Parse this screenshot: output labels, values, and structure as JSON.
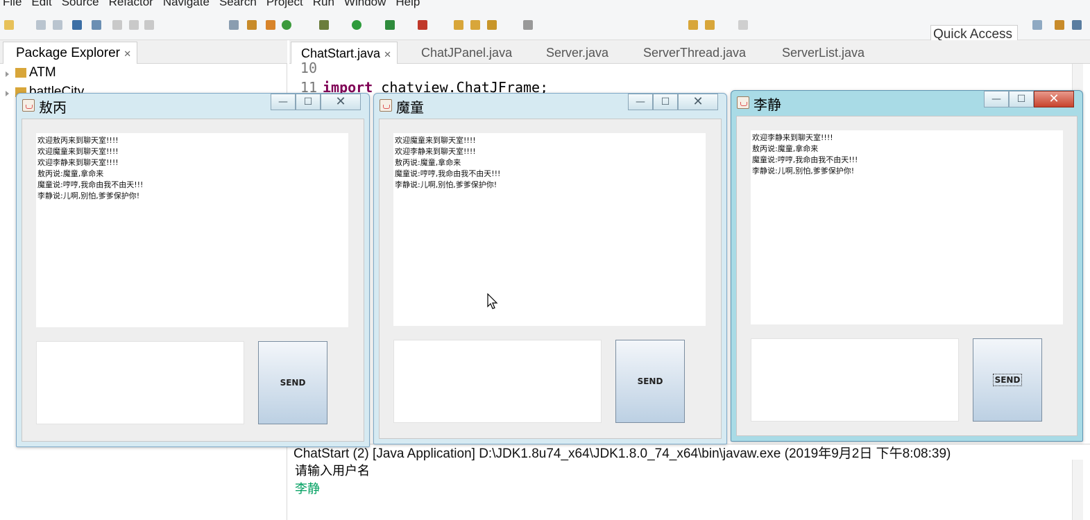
{
  "menu": [
    "File",
    "Edit",
    "Source",
    "Refactor",
    "Navigate",
    "Search",
    "Project",
    "Run",
    "Window",
    "Help"
  ],
  "toolbar": {
    "quick_access": "Quick Access"
  },
  "package_explorer": {
    "tab_label": "Package Explorer",
    "items": [
      "ATM",
      "battleCity"
    ]
  },
  "editor": {
    "tabs": [
      "ChatStart.java",
      "ChatJPanel.java",
      "Server.java",
      "ServerThread.java",
      "ServerList.java"
    ],
    "lines": [
      {
        "num": "10",
        "keyword": "",
        "text": ""
      },
      {
        "num": "11",
        "keyword": "import",
        "text": " chatview.ChatJFrame;"
      }
    ]
  },
  "console": {
    "title": "ChatStart (2) [Java Application] D:\\JDK1.8u74_x64\\JDK1.8.0_74_x64\\bin\\javaw.exe (2019年9月2日 下午8:08:39)",
    "lines": [
      "请输入用户名",
      "李静"
    ],
    "input_color": "#00a060"
  },
  "windows": [
    {
      "title": "敖丙",
      "messages": [
        "欢迎敖丙来到聊天室!!!!",
        "欢迎魔童来到聊天室!!!!",
        "欢迎李静来到聊天室!!!!",
        "敖丙说:魔童,拿命来",
        "魔童说:哼哼,我命由我不由天!!!",
        "李静说:儿啊,别怕,爹爹保护你!"
      ],
      "send_label": "SEND",
      "min": "—",
      "max": "☐",
      "close": "✕"
    },
    {
      "title": "魔童",
      "messages": [
        "欢迎魔童来到聊天室!!!!",
        "欢迎李静来到聊天室!!!!",
        "敖丙说:魔童,拿命来",
        "魔童说:哼哼,我命由我不由天!!!",
        "李静说:儿啊,别怕,爹爹保护你!"
      ],
      "send_label": "SEND",
      "min": "—",
      "max": "☐",
      "close": "✕"
    },
    {
      "title": "李静",
      "messages": [
        "欢迎李静来到聊天室!!!!",
        "敖丙说:魔童,拿命来",
        "魔童说:哼哼,我命由我不由天!!!",
        "李静说:儿啊,别怕,爹爹保护你!"
      ],
      "send_label": "SEND",
      "min": "—",
      "max": "☐",
      "close": "✕"
    }
  ]
}
